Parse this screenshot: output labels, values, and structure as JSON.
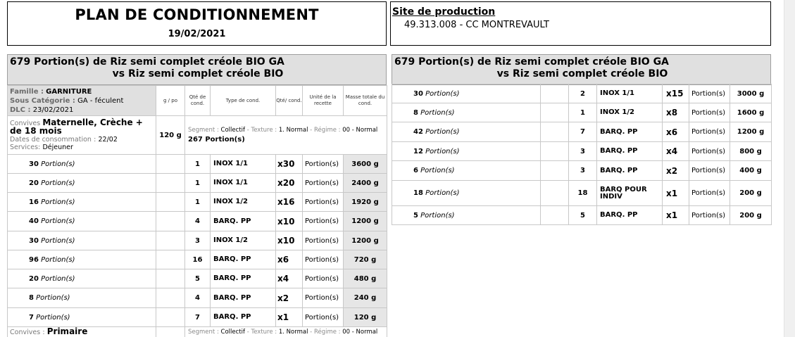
{
  "header": {
    "title": "PLAN DE CONDITIONNEMENT",
    "date": "19/02/2021",
    "site_label": "Site de production",
    "site_value": "49.313.008 - CC MONTREVAULT"
  },
  "product": {
    "title_line1": "679 Portion(s) de Riz semi complet créole BIO GA",
    "title_line2": "vs Riz semi complet créole BIO"
  },
  "famille": {
    "famille_label": "Famille :",
    "famille_value": "GARNITURE",
    "sous_label": "Sous Catégorie :",
    "sous_value": "GA - féculent",
    "dlc_label": "DLC :",
    "dlc_value": "23/02/2021"
  },
  "columns": {
    "gpo": "g / po",
    "qte_cond": "Qté de cond.",
    "type_cond": "Type de cond.",
    "qte": "Qté/ cond.",
    "unite": "Unité de la recette",
    "masse": "Masse totale du cond."
  },
  "convive1": {
    "convives_label": "Convives",
    "convives_value": "Maternelle, Crèche + de 18 mois",
    "dates_label": "Dates de consommation",
    "dates_value": "22/02",
    "services_label": "Services:",
    "services_value": "Déjeuner",
    "gpo": "120 g",
    "segment_label": "Segment",
    "segment_value": "Collectif",
    "texture_label": "Texture",
    "texture_value": "1. Normal",
    "regime_label": "Régime",
    "regime_value": "00 - Normal",
    "total": "267 Portion(s)"
  },
  "convive2": {
    "convives_label": "Convives",
    "convives_value": "Primaire",
    "segment_label": "Segment",
    "segment_value": "Collectif",
    "texture_label": "Texture",
    "texture_value": "1. Normal",
    "regime_label": "Régime",
    "regime_value": "00 - Normal"
  },
  "left_rows": [
    {
      "n": "30",
      "u": "Portion(s)",
      "qty": "1",
      "type": "INOX 1/1",
      "mult": "x30",
      "unit": "Portion(s)",
      "mass": "3600 g"
    },
    {
      "n": "20",
      "u": "Portion(s)",
      "qty": "1",
      "type": "INOX 1/1",
      "mult": "x20",
      "unit": "Portion(s)",
      "mass": "2400 g"
    },
    {
      "n": "16",
      "u": "Portion(s)",
      "qty": "1",
      "type": "INOX 1/2",
      "mult": "x16",
      "unit": "Portion(s)",
      "mass": "1920 g"
    },
    {
      "n": "40",
      "u": "Portion(s)",
      "qty": "4",
      "type": "BARQ. PP",
      "mult": "x10",
      "unit": "Portion(s)",
      "mass": "1200 g"
    },
    {
      "n": "30",
      "u": "Portion(s)",
      "qty": "3",
      "type": "INOX 1/2",
      "mult": "x10",
      "unit": "Portion(s)",
      "mass": "1200 g"
    },
    {
      "n": "96",
      "u": "Portion(s)",
      "qty": "16",
      "type": "BARQ. PP",
      "mult": "x6",
      "unit": "Portion(s)",
      "mass": "720 g"
    },
    {
      "n": "20",
      "u": "Portion(s)",
      "qty": "5",
      "type": "BARQ. PP",
      "mult": "x4",
      "unit": "Portion(s)",
      "mass": "480 g"
    },
    {
      "n": "8",
      "u": "Portion(s)",
      "qty": "4",
      "type": "BARQ. PP",
      "mult": "x2",
      "unit": "Portion(s)",
      "mass": "240 g"
    },
    {
      "n": "7",
      "u": "Portion(s)",
      "qty": "7",
      "type": "BARQ. PP",
      "mult": "x1",
      "unit": "Portion(s)",
      "mass": "120 g"
    }
  ],
  "right_rows": [
    {
      "n": "30",
      "u": "Portion(s)",
      "qty": "2",
      "type": "INOX 1/1",
      "mult": "x15",
      "unit": "Portion(s)",
      "mass": "3000 g"
    },
    {
      "n": "8",
      "u": "Portion(s)",
      "qty": "1",
      "type": "INOX 1/2",
      "mult": "x8",
      "unit": "Portion(s)",
      "mass": "1600 g"
    },
    {
      "n": "42",
      "u": "Portion(s)",
      "qty": "7",
      "type": "BARQ. PP",
      "mult": "x6",
      "unit": "Portion(s)",
      "mass": "1200 g"
    },
    {
      "n": "12",
      "u": "Portion(s)",
      "qty": "3",
      "type": "BARQ. PP",
      "mult": "x4",
      "unit": "Portion(s)",
      "mass": "800 g"
    },
    {
      "n": "6",
      "u": "Portion(s)",
      "qty": "3",
      "type": "BARQ. PP",
      "mult": "x2",
      "unit": "Portion(s)",
      "mass": "400 g"
    },
    {
      "n": "18",
      "u": "Portion(s)",
      "qty": "18",
      "type": "BARQ POUR INDIV",
      "mult": "x1",
      "unit": "Portion(s)",
      "mass": "200 g"
    },
    {
      "n": "5",
      "u": "Portion(s)",
      "qty": "5",
      "type": "BARQ. PP",
      "mult": "x1",
      "unit": "Portion(s)",
      "mass": "200 g"
    }
  ]
}
